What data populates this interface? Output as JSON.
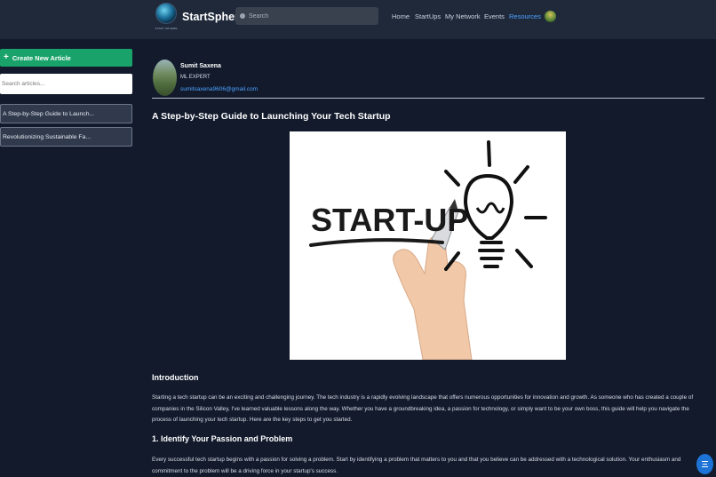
{
  "header": {
    "logo_caption": "START SPHERE",
    "brand": "StartSphere",
    "search_placeholder": "Search",
    "nav": [
      "Home",
      "StartUps",
      "My Network",
      "Events",
      "Resources"
    ],
    "active_nav": "Resources"
  },
  "sidebar": {
    "create_label": "Create New Article",
    "search_placeholder": "Search articles...",
    "articles": [
      "A Step-by-Step Guide to Launch...",
      "Revolutionizing Sustainable Fa..."
    ]
  },
  "author": {
    "name": "Sumit Saxena",
    "role": "ML EXPERT",
    "email": "sumitsaxena9606@gmail.com"
  },
  "article": {
    "title": "A Step-by-Step Guide to Launching Your Tech Startup",
    "image_text": "START-UP",
    "intro_heading": "Introduction",
    "intro_text": "Starting a tech startup can be an exciting and challenging journey. The tech industry is a rapidly evolving landscape that offers numerous opportunities for innovation and growth. As someone who has created a couple of companies in the Silicon Valley, I've learned valuable lessons along the way. Whether you have a groundbreaking idea, a passion for technology, or simply want to be your own boss, this guide will help you navigate the process of launching your tech startup. Here are the key steps to get you started.",
    "section1_heading": "1. Identify Your Passion and Problem",
    "section1_text": "Every successful tech startup begins with a passion for solving a problem. Start by identifying a problem that matters to you and that you believe can be addressed with a technological solution. Your enthusiasm and commitment to the problem will be a driving force in your startup's success."
  },
  "colors": {
    "background": "#121a2c",
    "topbar": "#1f293a",
    "accent_green": "#19a36a",
    "link_blue": "#4ea3ff",
    "fab_blue": "#1e74d6"
  }
}
